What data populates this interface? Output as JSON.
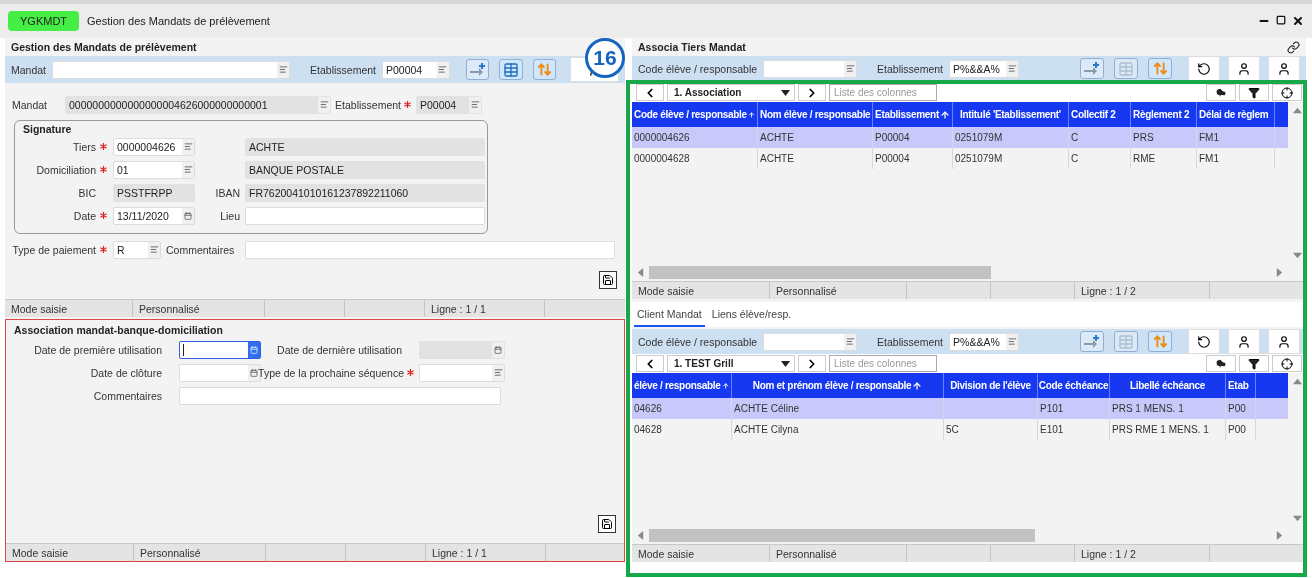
{
  "window": {
    "code": "YGKMDT",
    "title": "Gestion des Mandats de prélèvement"
  },
  "callout": {
    "number": "16"
  },
  "left": {
    "title": "Gestion des Mandats de prélèvement",
    "filter": [
      {
        "label": "Mandat",
        "kind": "list"
      },
      {
        "label": "Etablissement",
        "value": "P00004",
        "kind": "list"
      }
    ],
    "mandat": {
      "label": "Mandat",
      "required": false,
      "field": {
        "value": "0000000000000000004626000000000001",
        "readonly": true,
        "kind": "list"
      },
      "label2": "Etablissement",
      "required2": true,
      "field2": {
        "value": "P00004",
        "readonly": true,
        "kind": "list"
      }
    },
    "signature": {
      "title": "Signature",
      "rows": [
        {
          "label": "Tiers",
          "required": true,
          "field": {
            "value": "0000004626",
            "readonly": false,
            "kind": "list"
          },
          "wide": {
            "value": "ACHTE",
            "readonly": true
          }
        },
        {
          "label": "Domiciliation",
          "required": true,
          "field": {
            "value": "01",
            "readonly": false,
            "kind": "list"
          },
          "wide": {
            "value": "BANQUE POSTALE",
            "readonly": true
          }
        },
        {
          "label": "BIC",
          "required": false,
          "field": {
            "value": "PSSTFRPP",
            "readonly": true
          },
          "label2": "IBAN",
          "wide": {
            "value": "FR7620041010161237892211060",
            "readonly": true
          }
        },
        {
          "label": "Date",
          "required": true,
          "field": {
            "value": "13/11/2020",
            "readonly": false,
            "kind": "calendar"
          },
          "label2": "Lieu",
          "wide": {
            "readonly": false
          }
        }
      ]
    },
    "payment": {
      "label": "Type de paiement",
      "required": true,
      "field": {
        "value": "R",
        "readonly": false,
        "kind": "list"
      },
      "label2": "Commentaires",
      "wide": {
        "readonly": false
      }
    },
    "status": {
      "mode": "Mode saisie",
      "custom": "Personnalisé",
      "line": "Ligne : 1 / 1"
    },
    "bottom": {
      "title": "Association mandat-banque-domiciliation",
      "rows": [
        {
          "label": "Date de première utilisation",
          "required": false,
          "field": {
            "readonly": false,
            "focused": true,
            "kind": "calendar"
          },
          "label2": "Date de dernière utilisation",
          "required2": false,
          "field2": {
            "readonly": true,
            "focused": false,
            "kind": "calendar"
          }
        },
        {
          "label": "Date de clôture",
          "required": false,
          "field": {
            "readonly": false,
            "focused": false,
            "kind": "calendar"
          },
          "label2": "Type de la prochaine séquence",
          "required2": true,
          "field2": {
            "readonly": false,
            "focused": false,
            "kind": "list"
          }
        },
        {
          "label": "Commentaires",
          "required": false,
          "wide": {
            "readonly": false,
            "focused": false
          }
        }
      ],
      "status": {
        "mode": "Mode saisie",
        "custom": "Personnalisé",
        "line": "Ligne : 1 / 1"
      }
    }
  },
  "right": {
    "title": "Associa Tiers Mandat",
    "filter": [
      {
        "label": "Code élève / responsable",
        "kind": "list"
      },
      {
        "label": "Etablissement",
        "value": "P%&&A%",
        "kind": "list"
      }
    ],
    "grid": {
      "view": "1. Association",
      "placeholder": "Liste des colonnes",
      "columns": [
        {
          "label": "Code élève / responsable",
          "sorted": true
        },
        {
          "label": "Nom élève / responsable",
          "sorted": false
        },
        {
          "label": "Etablissement",
          "sorted": true
        },
        {
          "label": "Intitulé 'Etablissement'",
          "sorted": false
        },
        {
          "label": "Collectif 2",
          "sorted": false
        },
        {
          "label": "Règlement 2",
          "sorted": false
        },
        {
          "label": "Délai de règlem",
          "sorted": false
        }
      ],
      "rows": [
        {
          "selected": true,
          "cells": [
            "0000004626",
            "ACHTE",
            "P00004",
            "0251079M",
            "C",
            "PRS",
            "FM1"
          ]
        },
        {
          "selected": false,
          "cells": [
            "0000004628",
            "ACHTE",
            "P00004",
            "0251079M",
            "C",
            "RME",
            "FM1"
          ]
        }
      ],
      "status": {
        "mode": "Mode saisie",
        "custom": "Personnalisé",
        "line": "Ligne : 1 / 2"
      }
    },
    "tabs": [
      {
        "label": "Client Mandat",
        "selected": true
      },
      {
        "label": "Liens élève/resp.",
        "selected": false
      }
    ],
    "filter2": [
      {
        "label": "Code élève / responsable",
        "kind": "list"
      },
      {
        "label": "Etablissement",
        "value": "P%&&A%",
        "kind": "list"
      }
    ],
    "grid2": {
      "view": "1. TEST Grill",
      "placeholder": "Liste des colonnes",
      "columns": [
        {
          "label": "élève / responsable",
          "sorted": true
        },
        {
          "label": "Nom et prénom élève / responsable",
          "sorted": true
        },
        {
          "label": "Division de l'élève",
          "sorted": false
        },
        {
          "label": "Code échéance",
          "sorted": false
        },
        {
          "label": "Libellé échéance",
          "sorted": false
        },
        {
          "label": "Etab",
          "sorted": false
        }
      ],
      "rows": [
        {
          "selected": true,
          "cells": [
            "04626",
            "ACHTE Céline",
            null,
            "P101",
            "PRS 1 MENS. 1",
            "P00"
          ]
        },
        {
          "selected": false,
          "cells": [
            "04628",
            "ACHTE Cilyna",
            "5C",
            "E101",
            "PRS RME 1 MENS. 1",
            "P00"
          ]
        }
      ],
      "status": {
        "mode": "Mode saisie",
        "custom": "Personnalisé",
        "line": "Ligne : 1 / 2"
      }
    }
  }
}
